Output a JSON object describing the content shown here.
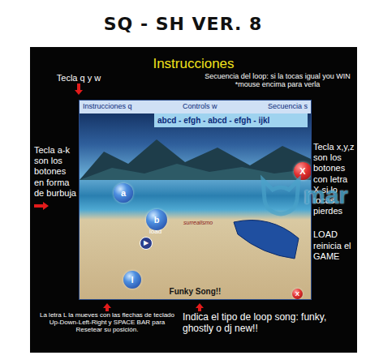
{
  "title": "SQ - SH VER. 8",
  "panel": {
    "heading": "Instrucciones"
  },
  "annotations": {
    "top_left": "Tecla q y w",
    "top_right": "Secuencia del loop: si la tocas igual you WIN *mouse encima para verla",
    "left": "Tecla a-k son los botones en forma de burbuja",
    "right_top": "Tecla x,y,z son los botones con letra X si lo tocas pierdes",
    "right_bottom": "LOAD reinicia el GAME",
    "bottom_left": "La letra L la mueves con las flechas de teclado Up-Down-Left-Right y SPACE BAR para Resetear su posición.",
    "bottom_right": "Indica el tipo de loop song: funky, ghostly o dj new!!"
  },
  "game": {
    "menu": [
      {
        "label": "Instrucciones q"
      },
      {
        "label": "Controls w"
      },
      {
        "label": "Secuencia s"
      }
    ],
    "sequence": "abcd - efgh - abcd - efgh - ijkl",
    "bubbles": [
      {
        "label": "a",
        "kind": "bubble"
      },
      {
        "label": "b",
        "kind": "bubble"
      },
      {
        "label": "l",
        "kind": "bubble"
      },
      {
        "label": "X",
        "kind": "danger"
      },
      {
        "label": "X",
        "kind": "danger"
      }
    ],
    "load": "load",
    "play": "▶",
    "signature": "surrealismo",
    "song": "Funky Song!!"
  },
  "watermark": "mar"
}
